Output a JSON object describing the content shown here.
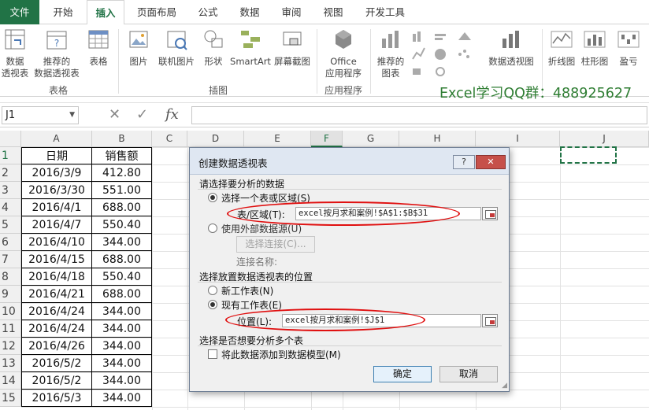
{
  "tabs": [
    "文件",
    "开始",
    "插入",
    "页面布局",
    "公式",
    "数据",
    "审阅",
    "视图",
    "开发工具"
  ],
  "ribbon": {
    "buttons": [
      {
        "line1": "数据",
        "line2": "透视表"
      },
      {
        "line1": "推荐的",
        "line2": "数据透视表"
      },
      {
        "line1": "表格",
        "line2": ""
      },
      {
        "line1": "图片",
        "line2": ""
      },
      {
        "line1": "联机图片",
        "line2": ""
      },
      {
        "line1": "形状",
        "line2": ""
      },
      {
        "line1": "SmartArt",
        "line2": ""
      },
      {
        "line1": "屏幕截图",
        "line2": ""
      },
      {
        "line1": "Office",
        "line2": "应用程序"
      },
      {
        "line1": "推荐的",
        "line2": "图表"
      },
      {
        "line1": "数据透视图",
        "line2": ""
      },
      {
        "line1": "折线图",
        "line2": ""
      },
      {
        "line1": "柱形图",
        "line2": ""
      },
      {
        "line1": "盈亏",
        "line2": ""
      }
    ],
    "groups": [
      "表格",
      "插图",
      "应用程序"
    ],
    "qq_text": "Excel学习QQ群：488925627"
  },
  "formula_bar": {
    "name_box": "J1",
    "fx": "fx",
    "value": ""
  },
  "columns": [
    "A",
    "B",
    "C",
    "D",
    "E",
    "F",
    "G",
    "H",
    "I",
    "J"
  ],
  "rows": [
    "1",
    "2",
    "3",
    "4",
    "5",
    "6",
    "7",
    "8",
    "9",
    "10",
    "11",
    "12",
    "13",
    "14",
    "15"
  ],
  "table": {
    "headers": [
      "日期",
      "销售额"
    ],
    "data": [
      [
        "2016/3/9",
        "412.80"
      ],
      [
        "2016/3/30",
        "551.00"
      ],
      [
        "2016/4/1",
        "688.00"
      ],
      [
        "2016/4/7",
        "550.40"
      ],
      [
        "2016/4/10",
        "344.00"
      ],
      [
        "2016/4/15",
        "688.00"
      ],
      [
        "2016/4/18",
        "550.40"
      ],
      [
        "2016/4/21",
        "688.00"
      ],
      [
        "2016/4/24",
        "344.00"
      ],
      [
        "2016/4/24",
        "344.00"
      ],
      [
        "2016/4/26",
        "344.00"
      ],
      [
        "2016/5/2",
        "344.00"
      ],
      [
        "2016/5/2",
        "344.00"
      ],
      [
        "2016/5/3",
        "344.00"
      ]
    ]
  },
  "dialog": {
    "title": "创建数据透视表",
    "help": "?",
    "close": "✕",
    "section1": "请选择要分析的数据",
    "option_table": "选择一个表或区域(S)",
    "range_label": "表/区域(T):",
    "range_value": "excel按月求和案例!$A$1:$B$31",
    "option_external": "使用外部数据源(U)",
    "choose_connection": "选择连接(C)...",
    "connection_name": "连接名称:",
    "section2": "选择放置数据透视表的位置",
    "option_new": "新工作表(N)",
    "option_existing": "现有工作表(E)",
    "location_label": "位置(L):",
    "location_value": "excel按月求和案例!$J$1",
    "section3": "选择是否想要分析多个表",
    "add_model": "将此数据添加到数据模型(M)",
    "ok": "确定",
    "cancel": "取消"
  }
}
